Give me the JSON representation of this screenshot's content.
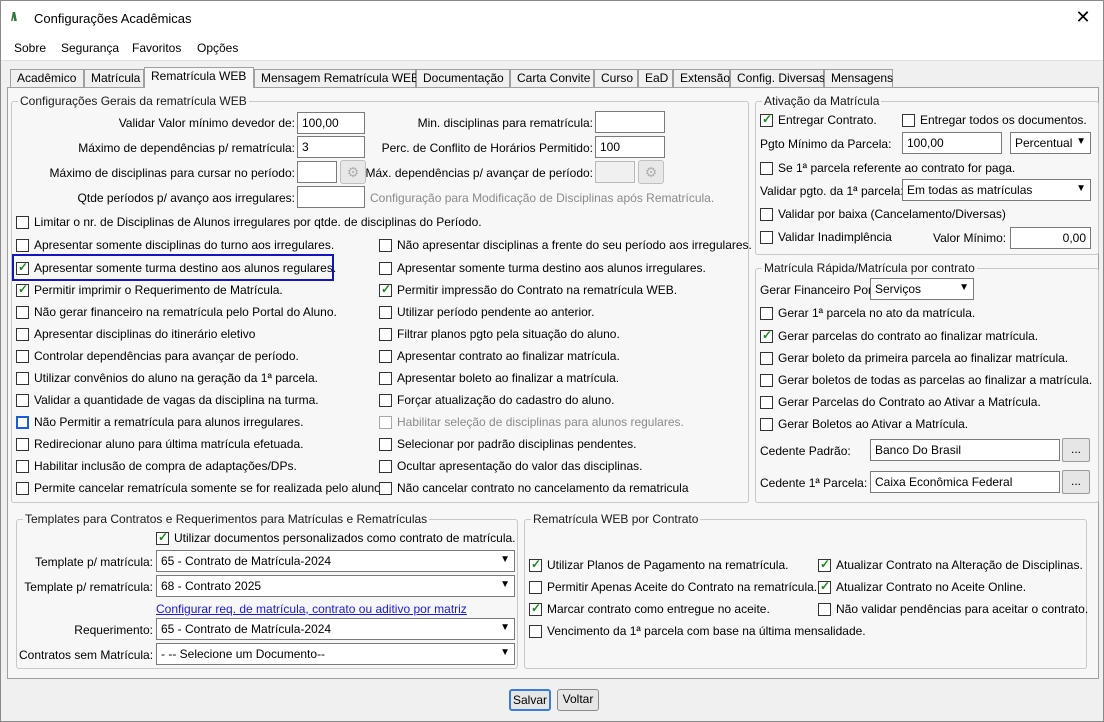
{
  "window": {
    "title": "Configurações Acadêmicas",
    "close": "✕"
  },
  "menu": {
    "items": [
      "Sobre",
      "Segurança",
      "Favoritos",
      "Opções"
    ]
  },
  "tabs": [
    "Acadêmico",
    "Matrícula",
    "Rematrícula WEB",
    "Mensagem Rematrícula WEB",
    "Documentação",
    "Carta Convite",
    "Curso",
    "EaD",
    "Extensão",
    "Config. Diversas",
    "Mensagens"
  ],
  "general": {
    "title": "Configurações Gerais da rematrícula WEB",
    "valor_min_devedor_label": "Validar Valor mínimo devedor de:",
    "valor_min_devedor": "100,00",
    "max_dependencias_label": "Máximo de dependências p/ rematrícula:",
    "max_dependencias": "3",
    "max_disciplinas_label": "Máximo de disciplinas para cursar no período:",
    "max_disciplinas": "",
    "qtde_periodos_label": "Qtde períodos p/ avanço aos irregulares:",
    "qtde_periodos": "",
    "min_disciplinas_label": "Min. disciplinas para rematrícula:",
    "min_disciplinas": "",
    "perc_conflito_label": "Perc. de Conflito de Horários Permitido:",
    "perc_conflito": "100",
    "max_dep_avancar_label": "Máx. dependências p/ avançar de período:",
    "max_dep_avancar": "",
    "config_modificacao": "Configuração para Modificação de Disciplinas após Rematrícula.",
    "limitar": "Limitar o nr. de Disciplinas de Alunos irregulares por qtde. de disciplinas do Período.",
    "left_checks": [
      {
        "label": "Apresentar somente disciplinas do turno aos irregulares.",
        "checked": false
      },
      {
        "label": "Apresentar somente turma destino aos alunos regulares.",
        "checked": true
      },
      {
        "label": "Permitir imprimir o Requerimento de Matrícula.",
        "checked": true
      },
      {
        "label": "Não gerar financeiro na rematrícula pelo Portal do Aluno.",
        "checked": false
      },
      {
        "label": "Apresentar disciplinas do itinerário eletivo",
        "checked": false
      },
      {
        "label": "Controlar dependências para avançar de período.",
        "checked": false
      },
      {
        "label": "Utilizar convênios do aluno na geração da 1ª parcela.",
        "checked": false
      },
      {
        "label": "Validar a quantidade de vagas da disciplina na turma.",
        "checked": false
      },
      {
        "label": "Não Permitir a rematrícula para alunos irregulares.",
        "checked": false
      },
      {
        "label": "Redirecionar aluno para última matrícula efetuada.",
        "checked": false
      },
      {
        "label": "Habilitar inclusão de compra de adaptações/DPs.",
        "checked": false
      },
      {
        "label": "Permite cancelar rematrícula somente se for realizada pelo aluno.",
        "checked": false
      }
    ],
    "right_checks": [
      {
        "label": "Não apresentar disciplinas a frente do seu período aos irregulares.",
        "checked": false
      },
      {
        "label": "Apresentar somente turma destino aos alunos irregulares.",
        "checked": false
      },
      {
        "label": "Permitir impressão do Contrato na rematrícula WEB.",
        "checked": true
      },
      {
        "label": "Utilizar período pendente ao anterior.",
        "checked": false
      },
      {
        "label": "Filtrar planos pgto pela situação do aluno.",
        "checked": false
      },
      {
        "label": "Apresentar contrato ao finalizar matrícula.",
        "checked": false
      },
      {
        "label": "Apresentar boleto ao finalizar a matrícula.",
        "checked": false
      },
      {
        "label": "Forçar atualização do cadastro do aluno.",
        "checked": false
      },
      {
        "label": "Habilitar seleção de disciplinas para alunos regulares.",
        "checked": false
      },
      {
        "label": "Selecionar por padrão disciplinas pendentes.",
        "checked": false
      },
      {
        "label": "Ocultar apresentação do valor das disciplinas.",
        "checked": false
      },
      {
        "label": "Não cancelar contrato no cancelamento da rematricula",
        "checked": false
      }
    ]
  },
  "ativacao": {
    "title": "Ativação da Matrícula",
    "entregar_contrato": "Entregar Contrato.",
    "entregar_todos": "Entregar todos os documentos.",
    "pgto_min_label": "Pgto Mínimo da Parcela:",
    "pgto_min": "100,00",
    "pgto_tipo": "Percentual",
    "primeira_parcela": "Se 1ª parcela referente ao contrato for paga.",
    "validar_pgto_label": "Validar pgto. da 1ª parcela:",
    "validar_pgto": "Em todas as matrículas",
    "validar_baixa": "Validar por baixa (Cancelamento/Diversas)",
    "validar_inadimplencia": "Validar Inadimplência",
    "valor_minimo_label": "Valor Mínimo:",
    "valor_minimo": "0,00"
  },
  "rapida": {
    "title": "Matrícula Rápida/Matrícula por contrato",
    "gerar_fin_label": "Gerar Financeiro Por:",
    "gerar_fin": "Serviços",
    "checks": [
      {
        "label": "Gerar 1ª parcela no ato da matrícula.",
        "checked": false
      },
      {
        "label": "Gerar parcelas do contrato ao finalizar matrícula.",
        "checked": true
      },
      {
        "label": "Gerar boleto da primeira parcela ao finalizar matrícula.",
        "checked": false
      },
      {
        "label": "Gerar boletos de todas as parcelas ao finalizar a matrícula.",
        "checked": false
      },
      {
        "label": "Gerar Parcelas do Contrato ao Ativar a Matrícula.",
        "checked": false
      },
      {
        "label": "Gerar Boletos ao Ativar a Matrícula.",
        "checked": false
      }
    ],
    "cedente_padrao_label": "Cedente Padrão:",
    "cedente_padrao": "Banco Do Brasil",
    "cedente_primeira_label": "Cedente 1ª Parcela:",
    "cedente_primeira": "Caixa Econômica Federal",
    "dots": "..."
  },
  "templates": {
    "title": "Templates para Contratos e Requerimentos para Matrículas e Rematrículas",
    "utilizar_docs": "Utilizar documentos personalizados como contrato de matrícula.",
    "template_matricula_label": "Template p/ matrícula:",
    "template_matricula": "65 - Contrato de Matrícula-2024",
    "template_rematricula_label": "Template p/ rematrícula:",
    "template_rematricula": "68 - Contrato 2025",
    "link": "Configurar req. de matrícula, contrato ou aditivo por matriz",
    "requerimento_label": "Requerimento:",
    "requerimento": "65 - Contrato de Matrícula-2024",
    "sem_matricula_label": "Contratos sem Matrícula:",
    "sem_matricula": "- -- Selecione um Documento--"
  },
  "webcontrato": {
    "title": "Rematrícula WEB por Contrato",
    "checks": [
      {
        "label": "Utilizar Planos de Pagamento na rematrícula.",
        "checked": true
      },
      {
        "label": "Atualizar Contrato na Alteração de Disciplinas.",
        "checked": true
      },
      {
        "label": "Permitir Apenas Aceite do Contrato na rematrícula.",
        "checked": false
      },
      {
        "label": "Atualizar Contrato no Aceite Online.",
        "checked": true
      },
      {
        "label": "Marcar contrato como entregue no aceite.",
        "checked": true
      },
      {
        "label": "Não validar pendências para aceitar o contrato.",
        "checked": false
      },
      {
        "label": "Vencimento da 1ª parcela com base na última mensalidade.",
        "checked": false
      }
    ]
  },
  "buttons": {
    "save": "Salvar",
    "back": "Voltar"
  }
}
